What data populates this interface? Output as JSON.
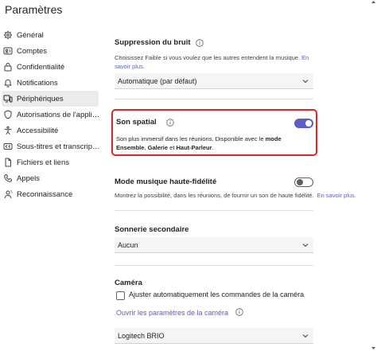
{
  "window": {
    "title": "Paramètres"
  },
  "sidebar": {
    "items": [
      {
        "label": "Général",
        "icon": "gear-icon"
      },
      {
        "label": "Comptes",
        "icon": "accounts-icon"
      },
      {
        "label": "Confidentialité",
        "icon": "lock-icon"
      },
      {
        "label": "Notifications",
        "icon": "bell-icon"
      },
      {
        "label": "Périphériques",
        "icon": "devices-icon",
        "active": true
      },
      {
        "label": "Autorisations de l'applic…",
        "icon": "shield-icon"
      },
      {
        "label": "Accessibilité",
        "icon": "accessibility-icon"
      },
      {
        "label": "Sous-titres et transcripti…",
        "icon": "captions-icon"
      },
      {
        "label": "Fichiers et liens",
        "icon": "file-icon"
      },
      {
        "label": "Appels",
        "icon": "phone-icon"
      },
      {
        "label": "Reconnaissance",
        "icon": "recognition-icon"
      }
    ]
  },
  "noise": {
    "title": "Suppression du bruit",
    "desc": "Choisissez Faible si vous voulez que les autres entendent la musique.",
    "link": "En savoir plus.",
    "select": "Automatique (par défaut)"
  },
  "spatial": {
    "title": "Son spatial",
    "desc_pre": "Son plus immersif dans les réunions. Disponible avec le",
    "bold1": "mode Ensemble",
    "sep": ",",
    "bold2": "Galerie",
    "and": "et",
    "bold3": "Haut-Parleur",
    "end": ".",
    "enabled": true
  },
  "music": {
    "title": "Mode musique haute-fidélité",
    "desc": "Montrez la possibilité, dans les réunions, de fournir un son de haute fidélité.",
    "link": "En savoir plus.",
    "enabled": false
  },
  "ringer": {
    "title": "Sonnerie secondaire",
    "select": "Aucun"
  },
  "camera": {
    "title": "Caméra",
    "checkbox_label": "Ajuster automatiquement les commandes de la caméra",
    "link": "Ouvrir les paramètres de la caméra",
    "select": "Logitech BRIO"
  },
  "colors": {
    "accent": "#5b5fc7",
    "highlight": "#d92a2a"
  }
}
